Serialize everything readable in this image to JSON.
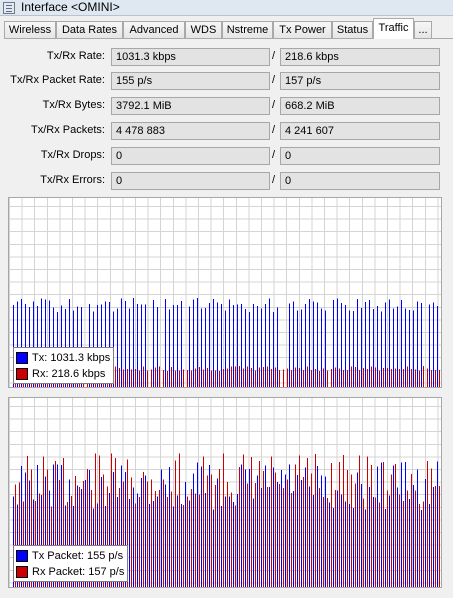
{
  "window": {
    "title": "Interface <OMINI>"
  },
  "tabs": [
    {
      "label": "Wireless",
      "active": false
    },
    {
      "label": "Data Rates",
      "active": false
    },
    {
      "label": "Advanced",
      "active": false
    },
    {
      "label": "WDS",
      "active": false
    },
    {
      "label": "Nstreme",
      "active": false
    },
    {
      "label": "Tx Power",
      "active": false
    },
    {
      "label": "Status",
      "active": false
    },
    {
      "label": "Traffic",
      "active": true
    },
    {
      "label": "...",
      "active": false
    }
  ],
  "fields": [
    {
      "label": "Tx/Rx Rate:",
      "tx": "1031.3 kbps",
      "rx": "218.6 kbps"
    },
    {
      "label": "Tx/Rx Packet Rate:",
      "tx": "155 p/s",
      "rx": "157 p/s"
    },
    {
      "label": "Tx/Rx Bytes:",
      "tx": "3792.1 MiB",
      "rx": "668.2 MiB"
    },
    {
      "label": "Tx/Rx Packets:",
      "tx": "4 478 883",
      "rx": "4 241 607"
    },
    {
      "label": "Tx/Rx Drops:",
      "tx": "0",
      "rx": "0"
    },
    {
      "label": "Tx/Rx Errors:",
      "tx": "0",
      "rx": "0"
    }
  ],
  "separator": "/",
  "colors": {
    "tx": "#0000ff",
    "rx": "#cc0000",
    "grid": "#d4d4d4",
    "graph_bg": "#ffffff"
  },
  "graphs": [
    {
      "name": "traffic",
      "legend": [
        {
          "label": "Tx:  1031.3 kbps",
          "color": "#0000ff"
        },
        {
          "label": "Rx:  218.6 kbps",
          "color": "#cc0000"
        }
      ]
    },
    {
      "name": "packets",
      "legend": [
        {
          "label": "Tx Packet:  155 p/s",
          "color": "#0000ff"
        },
        {
          "label": "Rx Packet:  157 p/s",
          "color": "#cc0000"
        }
      ]
    }
  ]
}
